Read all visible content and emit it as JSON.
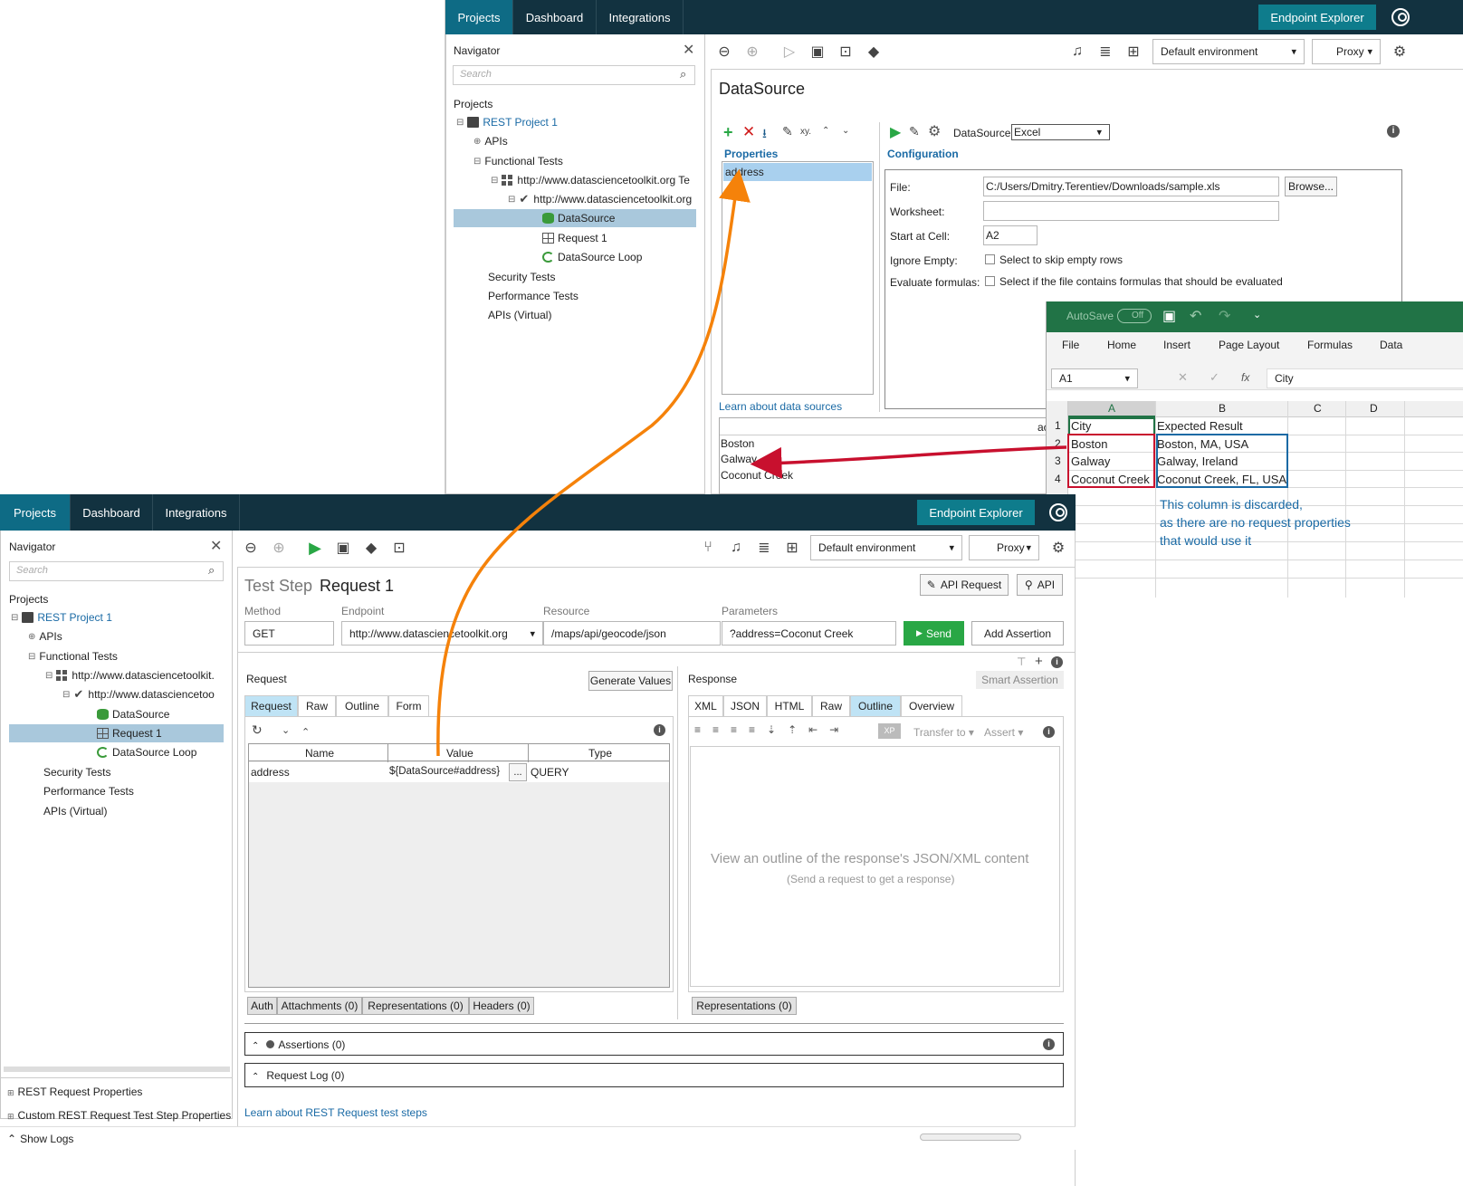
{
  "top": {
    "tabs": [
      "Projects",
      "Dashboard",
      "Integrations"
    ],
    "endpoint_explorer": "Endpoint Explorer",
    "navigator_title": "Navigator",
    "search_placeholder": "Search",
    "projects_label": "Projects",
    "tree": {
      "project": "REST Project 1",
      "apis": "APIs",
      "functional": "Functional Tests",
      "suite": "http://www.datasciencetoolkit.org Te",
      "testcase": "http://www.datasciencetoolkit.org",
      "datasource": "DataSource",
      "request": "Request 1",
      "loop": "DataSource Loop",
      "security": "Security Tests",
      "performance": "Performance Tests",
      "virtual": "APIs (Virtual)"
    },
    "environment": "Default environment",
    "proxy": "Proxy",
    "panel_title": "DataSource",
    "properties_label": "Properties",
    "property_item": "address",
    "configuration_label": "Configuration",
    "datasource_label": "DataSource:",
    "datasource_value": "Excel",
    "file_label": "File:",
    "file_value": "C:/Users/Dmitry.Terentiev/Downloads/sample.xls",
    "browse": "Browse...",
    "worksheet_label": "Worksheet:",
    "start_label": "Start at Cell:",
    "start_value": "A2",
    "ignore_label": "Ignore Empty:",
    "ignore_text": "Select to skip empty rows",
    "eval_label": "Evaluate formulas:",
    "eval_text": "Select if the file contains formulas that should be evaluated",
    "learn_link": "Learn about data sources",
    "grid_header": "ac",
    "grid_rows": [
      "Boston",
      "Galway",
      "Coconut Creek"
    ]
  },
  "excel": {
    "autosave": "AutoSave",
    "toggle": "Off",
    "ribbon": [
      "File",
      "Home",
      "Insert",
      "Page Layout",
      "Formulas",
      "Data"
    ],
    "namebox": "A1",
    "formula": "City",
    "fx": "fx",
    "cols": [
      "A",
      "B",
      "C",
      "D"
    ],
    "rownums": [
      "1",
      "2",
      "3",
      "4"
    ],
    "col_a": [
      "City",
      "Boston",
      "Galway",
      "Coconut Creek"
    ],
    "col_b": [
      "Expected Result",
      "Boston, MA, USA",
      "Galway, Ireland",
      "Coconut Creek, FL, USA"
    ],
    "note_line1": "This column is discarded,",
    "note_line2": "as there are no request properties",
    "note_line3": "that would use it"
  },
  "bottom": {
    "tabs": [
      "Projects",
      "Dashboard",
      "Integrations"
    ],
    "endpoint_explorer": "Endpoint Explorer",
    "navigator_title": "Navigator",
    "search_placeholder": "Search",
    "projects_label": "Projects",
    "tree": {
      "project": "REST Project 1",
      "apis": "APIs",
      "functional": "Functional Tests",
      "suite": "http://www.datasciencetoolkit.",
      "testcase": "http://www.datasciencetoo",
      "datasource": "DataSource",
      "request": "Request 1",
      "loop": "DataSource Loop",
      "security": "Security Tests",
      "performance": "Performance Tests",
      "virtual": "APIs (Virtual)"
    },
    "nav_footer": [
      "REST Request Properties",
      "Custom REST Request Test Step Properties"
    ],
    "show_logs": "Show Logs",
    "environment": "Default environment",
    "proxy": "Proxy",
    "title_prefix": "Test Step",
    "title": "Request 1",
    "api_request_btn": "API Request",
    "api_btn": "API",
    "method_label": "Method",
    "method_value": "GET",
    "endpoint_label": "Endpoint",
    "endpoint_value": "http://www.datasciencetoolkit.org",
    "resource_label": "Resource",
    "resource_value": "/maps/api/geocode/json",
    "parameters_label": "Parameters",
    "parameters_value": "?address=Coconut Creek",
    "send": "Send",
    "add_assertion": "Add Assertion",
    "smart_assertion": "Smart Assertion",
    "request_label": "Request",
    "generate_values": "Generate Values",
    "request_tabs": [
      "Request",
      "Raw",
      "Outline",
      "Form"
    ],
    "table_headers": [
      "Name",
      "Value",
      "Type"
    ],
    "row": {
      "name": "address",
      "value": "${DataSource#address}",
      "type": "QUERY",
      "more": "..."
    },
    "request_bottom_tabs": [
      "Auth",
      "Attachments (0)",
      "Representations (0)",
      "Headers (0)"
    ],
    "response_label": "Response",
    "response_tabs": [
      "XML",
      "JSON",
      "HTML",
      "Raw",
      "Outline",
      "Overview"
    ],
    "transfer_to": "Transfer to",
    "assert": "Assert",
    "empty_main": "View an outline of the response's JSON/XML content",
    "empty_sub": "(Send a request to get a response)",
    "response_bottom_tab": "Representations (0)",
    "assertions": "Assertions (0)",
    "request_log": "Request Log (0)",
    "learn_link": "Learn about REST Request test steps"
  },
  "colors": {
    "topbar": "#123240",
    "active_tab": "#0e6b85",
    "accent_orange": "#f5820a",
    "arrow_red": "#c8102e",
    "excel_green": "#217346",
    "note_blue": "#1a6aa5"
  }
}
